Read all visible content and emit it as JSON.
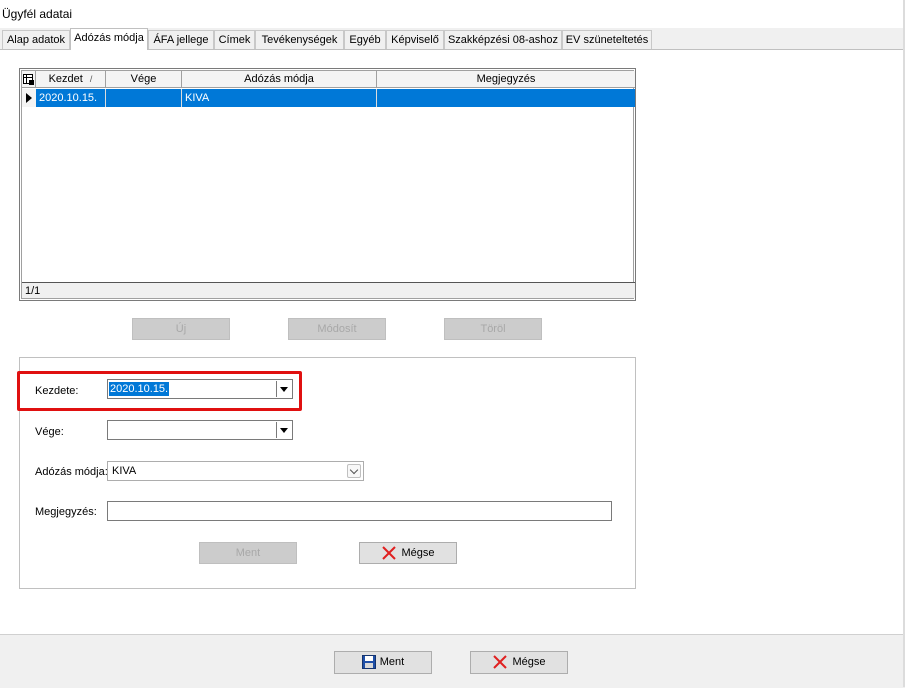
{
  "window": {
    "title": "Ügyfél adatai"
  },
  "tabs": [
    {
      "label": "Alap adatok"
    },
    {
      "label": "Adózás módja"
    },
    {
      "label": "ÁFA jellege"
    },
    {
      "label": "Címek"
    },
    {
      "label": "Tevékenységek"
    },
    {
      "label": "Egyéb"
    },
    {
      "label": "Képviselő"
    },
    {
      "label": "Szakképzési 08-ashoz"
    },
    {
      "label": "EV szüneteltetés"
    }
  ],
  "active_tab": "Adózás módja",
  "grid": {
    "columns": [
      "Kezdet",
      "Vége",
      "Adózás módja",
      "Megjegyzés"
    ],
    "sort_indicator": "/",
    "rows": [
      {
        "kezdet": "2020.10.15.",
        "vege": "",
        "adozas_modja": "KIVA",
        "megjegyzes": ""
      }
    ],
    "record_counter": "1/1"
  },
  "grid_buttons": {
    "new_label": "Új",
    "modify_label": "Módosít",
    "delete_label": "Töröl"
  },
  "form": {
    "kezdete_label": "Kezdete:",
    "kezdete_value": "2020.10.15.",
    "vege_label": "Vége:",
    "vege_value": "",
    "adozas_label": "Adózás módja:",
    "adozas_value": "KIVA",
    "megjegyzes_label": "Megjegyzés:",
    "megjegyzes_value": "",
    "save_label": "Ment",
    "cancel_label": "Mégse"
  },
  "footer": {
    "save_label": "Ment",
    "cancel_label": "Mégse"
  },
  "colors": {
    "selection": "#0078d7",
    "highlight_border": "#e01010",
    "cancel_icon": "#e02020",
    "save_icon": "#1f4fa8"
  }
}
